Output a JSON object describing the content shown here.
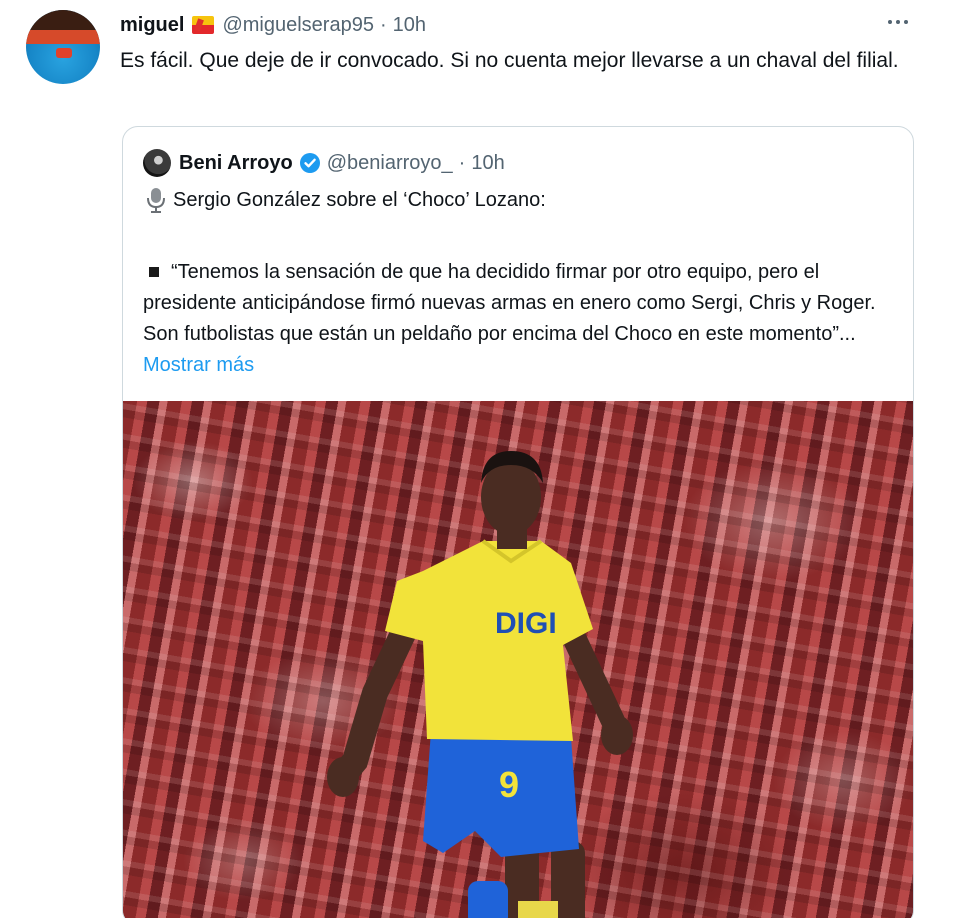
{
  "tweet": {
    "author_name": "miguel",
    "handle": "@miguelserap95",
    "separator": "·",
    "time": "10h",
    "text": "Es fácil. Que deje de ir convocado. Si no cuenta mejor llevarse a un chaval del filial."
  },
  "quoted_tweet": {
    "author_name": "Beni Arroyo",
    "handle": "@beniarroyo_",
    "separator": "·",
    "time": "10h",
    "intro": "Sergio González sobre el ‘Choco’ Lozano:",
    "body": "“Tenemos la sensación de que ha decidido firmar por otro equipo, pero el presidente anticipándose firmó nuevas armas en enero como Sergi, Chris y Roger. Son futbolistas que están un peldaño por encima del Choco en este momento”...",
    "show_more": "Mostrar más",
    "jersey": {
      "sponsor": "DIGI",
      "number": "9"
    }
  },
  "colors": {
    "link": "#1d9bf0",
    "secondary_text": "#536471",
    "border": "#cfd9de",
    "jersey_yellow": "#f2e33a",
    "shorts_blue": "#1f63d9"
  },
  "icons": [
    "more-icon",
    "flag-icon",
    "verified-icon",
    "microphone-icon",
    "bullet-icon"
  ]
}
